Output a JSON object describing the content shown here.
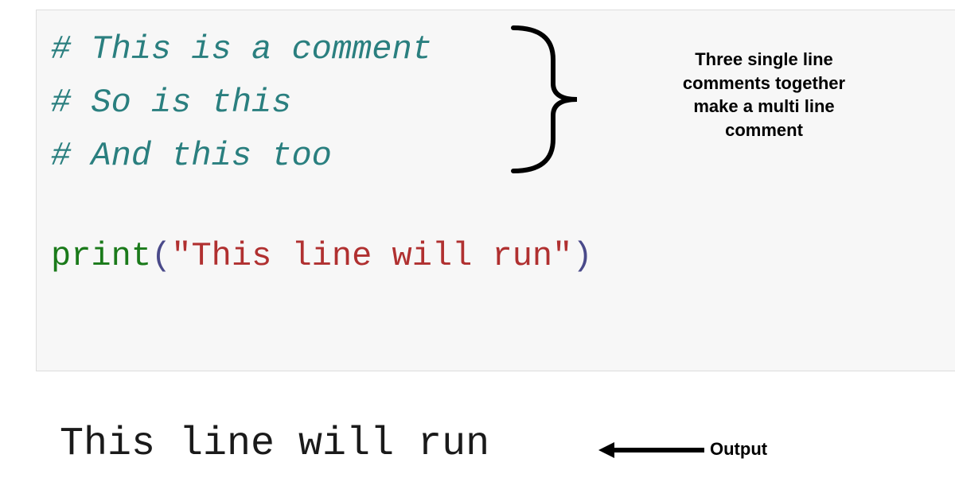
{
  "code": {
    "comment1": "# This is a comment",
    "comment2": "# So is this",
    "comment3": "# And this too",
    "print_fn": "print",
    "print_open": "(",
    "print_str": "\"This line will run\"",
    "print_close": ")"
  },
  "output": {
    "text": "This line will run"
  },
  "annotations": {
    "multi_comment": "Three single line comments together make a multi line comment",
    "output_label": "Output"
  }
}
